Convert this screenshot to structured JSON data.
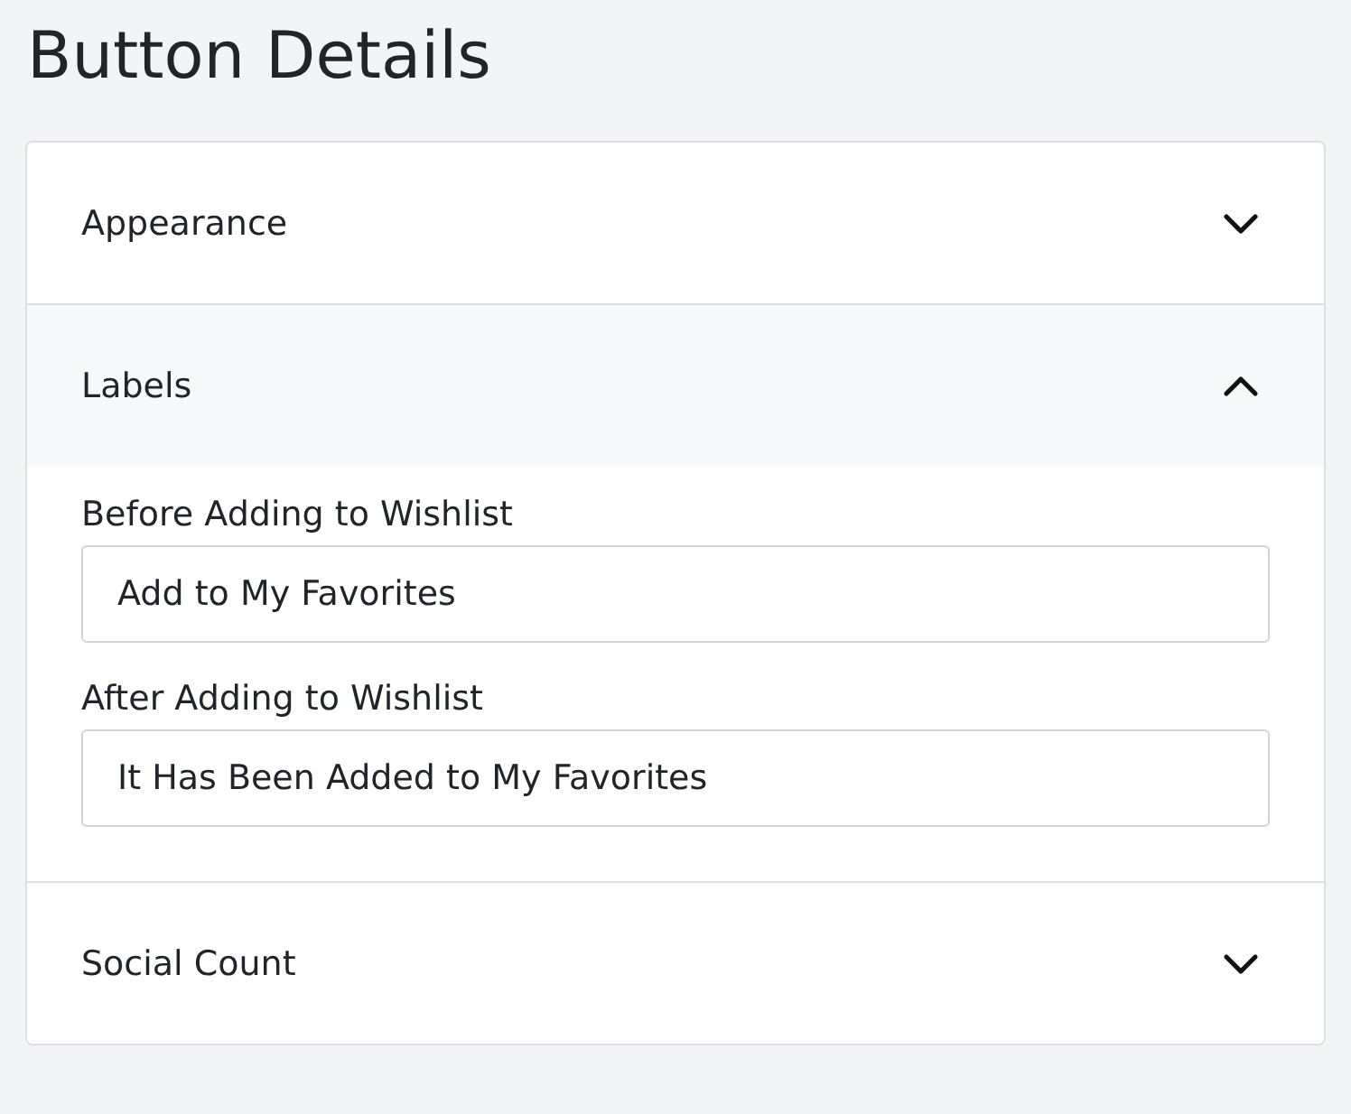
{
  "title": "Button Details",
  "sections": [
    {
      "label": "Appearance",
      "expanded": false
    },
    {
      "label": "Labels",
      "expanded": true,
      "fields": [
        {
          "label": "Before Adding to Wishlist",
          "value": "Add to My Favorites"
        },
        {
          "label": "After Adding to Wishlist",
          "value": "It Has Been Added to My Favorites"
        }
      ]
    },
    {
      "label": "Social Count",
      "expanded": false
    }
  ]
}
